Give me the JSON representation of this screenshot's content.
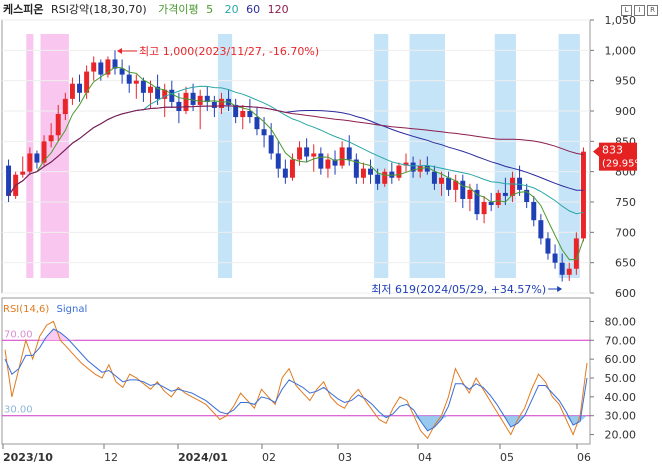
{
  "legend": {
    "stock": "케스피온",
    "indicator_name": "RSI강약(18,30,70)",
    "price_ma": "가격이평",
    "ma_labels": [
      "5",
      "20",
      "60",
      "120"
    ],
    "rsi_label": "RSI(14,6)",
    "signal_label": "Signal"
  },
  "colors": {
    "up": "#e8262a",
    "down": "#1f3fb5",
    "ma5": "#4a9a2e",
    "ma20": "#2aa6a6",
    "ma60": "#2b2b9e",
    "ma120": "#8b1e4e",
    "rsi": "#e07a1f",
    "signal": "#3a6ed6",
    "strong": "#f9c6f0",
    "weak": "#c6e4f7",
    "level_line": "#d236c6",
    "current_box": "#e52222"
  },
  "annotations": {
    "high": "최고 1,000(2023/11/27, -16.70%)",
    "low": "최저 619(2024/05/29, +34.57%)",
    "current_price": "833",
    "current_pct": "(29.95%)",
    "rsi_upper": "70.00",
    "rsi_lower": "30.00"
  },
  "chart_data": [
    {
      "type": "candlestick",
      "x_labels": [
        "2023/10",
        "12",
        "2024/01",
        "02",
        "03",
        "04",
        "05",
        "06"
      ],
      "y_ticks": [
        600,
        650,
        700,
        750,
        800,
        850,
        900,
        950,
        1000,
        1050
      ],
      "ylim": [
        600,
        1050
      ],
      "ohlc": [
        [
          810,
          820,
          750,
          760
        ],
        [
          760,
          800,
          755,
          795
        ],
        [
          795,
          825,
          790,
          800
        ],
        [
          800,
          840,
          795,
          830
        ],
        [
          830,
          835,
          805,
          815
        ],
        [
          815,
          860,
          810,
          850
        ],
        [
          850,
          880,
          840,
          860
        ],
        [
          860,
          910,
          850,
          895
        ],
        [
          895,
          930,
          885,
          920
        ],
        [
          920,
          955,
          910,
          945
        ],
        [
          945,
          960,
          915,
          930
        ],
        [
          930,
          975,
          920,
          965
        ],
        [
          965,
          990,
          950,
          980
        ],
        [
          980,
          985,
          950,
          960
        ],
        [
          960,
          990,
          955,
          985
        ],
        [
          985,
          1000,
          960,
          970
        ],
        [
          970,
          985,
          945,
          960
        ],
        [
          960,
          975,
          930,
          945
        ],
        [
          945,
          960,
          920,
          950
        ],
        [
          950,
          955,
          915,
          930
        ],
        [
          930,
          950,
          905,
          940
        ],
        [
          940,
          960,
          910,
          920
        ],
        [
          920,
          945,
          890,
          935
        ],
        [
          935,
          950,
          905,
          915
        ],
        [
          915,
          930,
          880,
          900
        ],
        [
          900,
          940,
          895,
          930
        ],
        [
          930,
          945,
          900,
          910
        ],
        [
          910,
          935,
          870,
          925
        ],
        [
          925,
          940,
          900,
          915
        ],
        [
          915,
          925,
          890,
          905
        ],
        [
          905,
          930,
          895,
          920
        ],
        [
          920,
          935,
          900,
          910
        ],
        [
          910,
          920,
          880,
          890
        ],
        [
          890,
          910,
          870,
          900
        ],
        [
          900,
          920,
          880,
          890
        ],
        [
          890,
          905,
          860,
          870
        ],
        [
          870,
          890,
          840,
          860
        ],
        [
          860,
          880,
          820,
          830
        ],
        [
          830,
          850,
          790,
          805
        ],
        [
          805,
          820,
          780,
          790
        ],
        [
          790,
          830,
          785,
          820
        ],
        [
          820,
          850,
          810,
          840
        ],
        [
          840,
          855,
          815,
          825
        ],
        [
          825,
          845,
          800,
          830
        ],
        [
          830,
          840,
          795,
          805
        ],
        [
          805,
          830,
          790,
          820
        ],
        [
          820,
          835,
          795,
          810
        ],
        [
          810,
          850,
          805,
          840
        ],
        [
          840,
          860,
          810,
          820
        ],
        [
          820,
          830,
          780,
          790
        ],
        [
          790,
          815,
          780,
          805
        ],
        [
          805,
          820,
          780,
          795
        ],
        [
          795,
          805,
          770,
          780
        ],
        [
          780,
          805,
          775,
          800
        ],
        [
          800,
          815,
          780,
          790
        ],
        [
          790,
          815,
          785,
          810
        ],
        [
          810,
          830,
          800,
          815
        ],
        [
          815,
          825,
          790,
          800
        ],
        [
          800,
          820,
          790,
          810
        ],
        [
          810,
          825,
          795,
          800
        ],
        [
          800,
          810,
          770,
          780
        ],
        [
          780,
          800,
          760,
          790
        ],
        [
          790,
          800,
          760,
          770
        ],
        [
          770,
          795,
          750,
          785
        ],
        [
          785,
          795,
          740,
          755
        ],
        [
          755,
          780,
          735,
          770
        ],
        [
          770,
          780,
          720,
          730
        ],
        [
          730,
          760,
          715,
          750
        ],
        [
          750,
          765,
          735,
          745
        ],
        [
          745,
          770,
          740,
          765
        ],
        [
          765,
          790,
          745,
          760
        ],
        [
          760,
          800,
          750,
          790
        ],
        [
          790,
          810,
          760,
          770
        ],
        [
          770,
          780,
          740,
          750
        ],
        [
          750,
          760,
          710,
          720
        ],
        [
          720,
          730,
          680,
          690
        ],
        [
          690,
          700,
          655,
          665
        ],
        [
          665,
          680,
          640,
          650
        ],
        [
          650,
          665,
          619,
          630
        ],
        [
          630,
          650,
          620,
          640
        ],
        [
          640,
          700,
          630,
          690
        ],
        [
          690,
          840,
          685,
          833
        ]
      ]
    },
    {
      "type": "line",
      "x_labels": [
        "2023/10",
        "12",
        "2024/01",
        "02",
        "03",
        "04",
        "05",
        "06"
      ],
      "y_ticks": [
        20,
        30,
        40,
        50,
        60,
        70,
        80
      ],
      "ylim": [
        15,
        85
      ],
      "levels": [
        70,
        30
      ],
      "series": [
        {
          "name": "RSI(14,6)",
          "values": [
            65,
            40,
            55,
            70,
            60,
            72,
            78,
            80,
            70,
            66,
            62,
            58,
            55,
            52,
            50,
            57,
            48,
            45,
            52,
            50,
            47,
            44,
            48,
            43,
            40,
            45,
            42,
            40,
            38,
            36,
            32,
            28,
            30,
            35,
            42,
            38,
            34,
            44,
            40,
            36,
            50,
            55,
            46,
            42,
            38,
            44,
            48,
            40,
            36,
            34,
            40,
            44,
            38,
            33,
            28,
            26,
            34,
            40,
            38,
            30,
            22,
            18,
            25,
            30,
            40,
            55,
            48,
            42,
            50,
            44,
            38,
            32,
            26,
            20,
            28,
            34,
            44,
            52,
            48,
            40,
            36,
            28,
            20,
            30,
            58
          ]
        },
        {
          "name": "Signal",
          "values": [
            60,
            52,
            55,
            62,
            62,
            66,
            72,
            76,
            74,
            71,
            67,
            63,
            59,
            56,
            53,
            54,
            51,
            48,
            49,
            49,
            48,
            46,
            47,
            45,
            43,
            44,
            43,
            42,
            40,
            38,
            35,
            32,
            31,
            33,
            37,
            37,
            36,
            40,
            39,
            37,
            44,
            49,
            47,
            45,
            42,
            43,
            45,
            42,
            39,
            37,
            38,
            41,
            39,
            36,
            32,
            29,
            31,
            35,
            36,
            33,
            27,
            22,
            24,
            28,
            35,
            47,
            47,
            44,
            47,
            45,
            41,
            36,
            30,
            24,
            26,
            30,
            38,
            46,
            46,
            42,
            38,
            32,
            25,
            27,
            50
          ]
        }
      ]
    }
  ]
}
